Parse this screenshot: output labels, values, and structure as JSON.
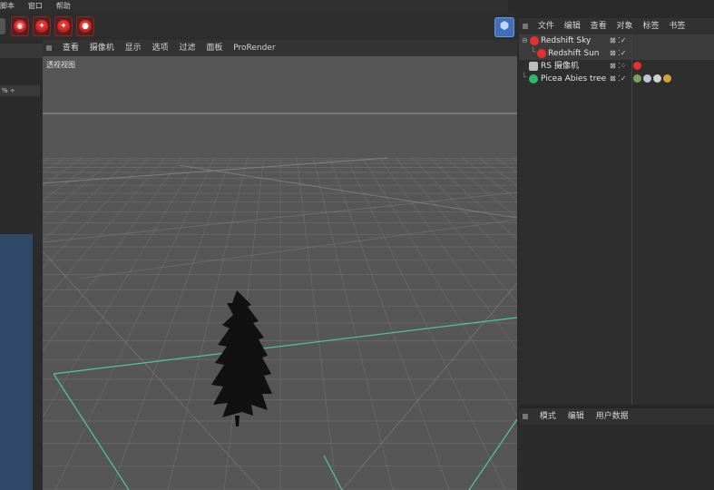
{
  "menubar": {
    "items": [
      "脚本",
      "窗口",
      "帮助"
    ]
  },
  "toolbar": {
    "buttons": [
      {
        "icon": "render-camera-icon",
        "glyph": "◉"
      },
      {
        "icon": "light-bulb-icon",
        "glyph": "✦"
      },
      {
        "icon": "spot-light-icon",
        "glyph": "✦"
      },
      {
        "icon": "redshift-object-icon",
        "glyph": "●"
      }
    ],
    "cube_icon": "cube-icon",
    "accent": "#e8302c"
  },
  "left_panel": {
    "field_value": "% ÷"
  },
  "viewport": {
    "menu": [
      "查看",
      "摄像机",
      "显示",
      "选项",
      "过滤",
      "面板",
      "ProRender"
    ],
    "label": "透视视图",
    "grid_color": "#6a6a6a",
    "horizon_color": "#9a9a9a",
    "guide_color": "#4fc7a0"
  },
  "object_manager": {
    "menu": [
      "文件",
      "编辑",
      "查看",
      "对象",
      "标签",
      "书签"
    ],
    "objects": [
      {
        "name": "Redshift Sky",
        "icon": "redshift-sky-icon",
        "color": "#e8302c",
        "flags": "⊠ ⁚✓"
      },
      {
        "name": "Redshift Sun",
        "icon": "redshift-sun-icon",
        "color": "#e8302c",
        "flags": "⊠ ⁚✓"
      },
      {
        "name": "RS 摄像机",
        "icon": "camera-icon",
        "color": "#c0c0c0",
        "flags": "⊠ ⁚⁘"
      },
      {
        "name": "Picea Abies tree",
        "icon": "tree-icon",
        "color": "#2fb86a",
        "flags": "⊠ ⁚✓"
      }
    ]
  },
  "attribute_manager": {
    "menu": [
      "模式",
      "编辑",
      "用户数据"
    ]
  }
}
